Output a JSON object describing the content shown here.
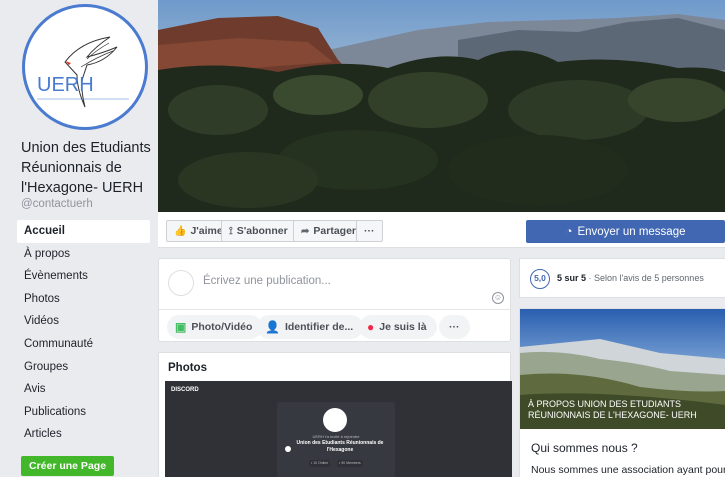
{
  "page": {
    "name": "Union des Etudiants Réunionnais de l'Hexagone- UERH",
    "handle": "@contactuerh",
    "logo_text": "UERH"
  },
  "sidebar": {
    "items": [
      {
        "label": "Accueil",
        "active": true
      },
      {
        "label": "À propos"
      },
      {
        "label": "Évènements"
      },
      {
        "label": "Photos"
      },
      {
        "label": "Vidéos"
      },
      {
        "label": "Communauté"
      },
      {
        "label": "Groupes"
      },
      {
        "label": "Avis"
      },
      {
        "label": "Publications"
      },
      {
        "label": "Articles"
      }
    ],
    "create_page_label": "Créer une Page"
  },
  "actions": {
    "like_label": "J'aime",
    "subscribe_label": "S'abonner",
    "share_label": "Partager",
    "more_label": "···",
    "message_label": "Envoyer un message"
  },
  "composer": {
    "placeholder": "Écrivez une publication...",
    "chips": {
      "photo": "Photo/Vidéo",
      "tag": "Identifier de...",
      "location": "Je suis là",
      "more": "···"
    }
  },
  "photos": {
    "title": "Photos",
    "thumb": {
      "tag": "DISCORD",
      "subtitle": "UERH t'a invité à rejoindre",
      "server_name": "Union des Etudiants Réunionnais de l'Hexagone",
      "online": "• 10 Online",
      "members": "• 90 Members"
    }
  },
  "rating": {
    "badge": "5,0",
    "score": "5 sur 5",
    "detail": " · Selon l'avis de 5 personnes"
  },
  "about": {
    "caption": "À PROPOS UNION DES ETUDIANTS RÉUNIONNAIS DE L'HEXAGONE- UERH",
    "question": "Qui sommes nous ?",
    "description": "Nous sommes une association ayant pour"
  },
  "colors": {
    "accent": "#4267b2",
    "create_button": "#42b72a",
    "logo_ring": "#4a7bd0"
  }
}
